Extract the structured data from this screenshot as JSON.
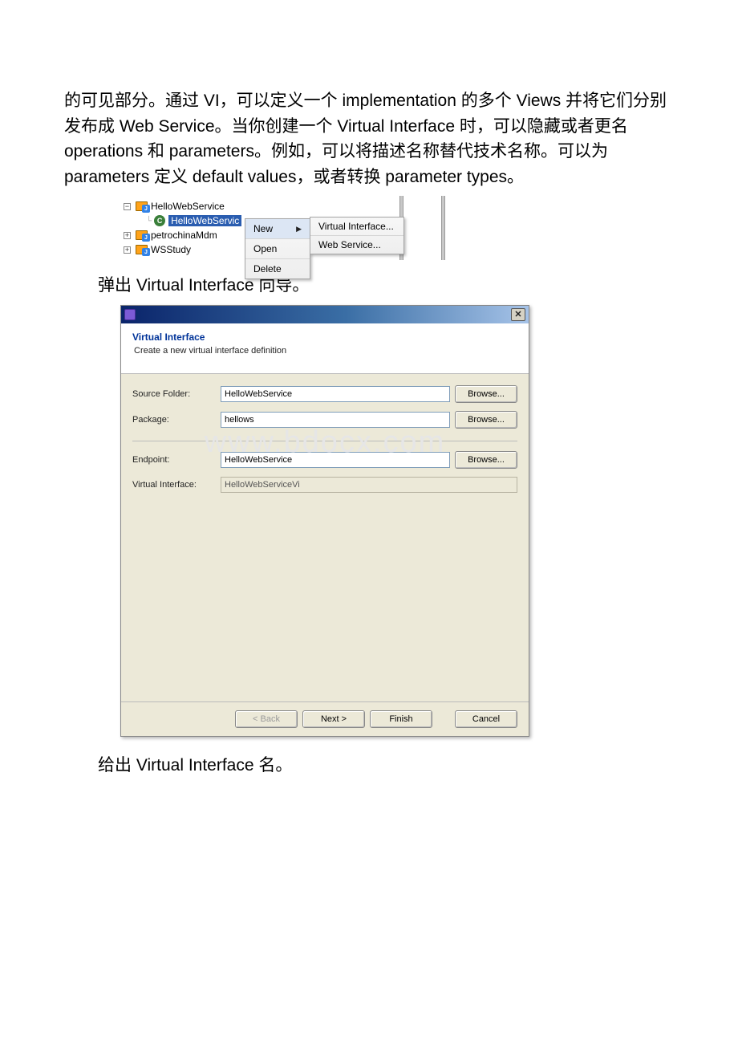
{
  "para1": "的可见部分。通过 VI，可以定义一个 implementation 的多个 Views 并将它们分别发布成 Web Service。当你创建一个 Virtual Interface 时，可以隐藏或者更名 operations 和 parameters。例如，可以将描述名称替代技术名称。可以为 parameters 定义 default values，或者转换 parameter types。",
  "para2": "弹出 Virtual Interface 向导。",
  "para3": "给出 Virtual Interface 名。",
  "tree": {
    "node1": "HelloWebService",
    "node1_sel": "HelloWebServic",
    "node2": "petrochinaMdm",
    "node3": "WSStudy",
    "class_letter": "C",
    "minus": "−",
    "plus": "+"
  },
  "ctx": {
    "new": "New",
    "open": "Open",
    "delete": "Delete",
    "vi": "Virtual Interface...",
    "ws": "Web Service..."
  },
  "wizard": {
    "title": "Virtual Interface",
    "subtitle": "Create a new virtual interface definition",
    "labels": {
      "source": "Source Folder:",
      "package": "Package:",
      "endpoint": "Endpoint:",
      "vi": "Virtual Interface:"
    },
    "values": {
      "source": "HelloWebService",
      "package": "hellows",
      "endpoint": "HelloWebService",
      "vi": "HelloWebServiceVi"
    },
    "buttons": {
      "browse": "Browse...",
      "back": "< Back",
      "next": "Next >",
      "finish": "Finish",
      "cancel": "Cancel"
    },
    "close_glyph": "✕"
  },
  "watermark": "www.bdocx.com"
}
